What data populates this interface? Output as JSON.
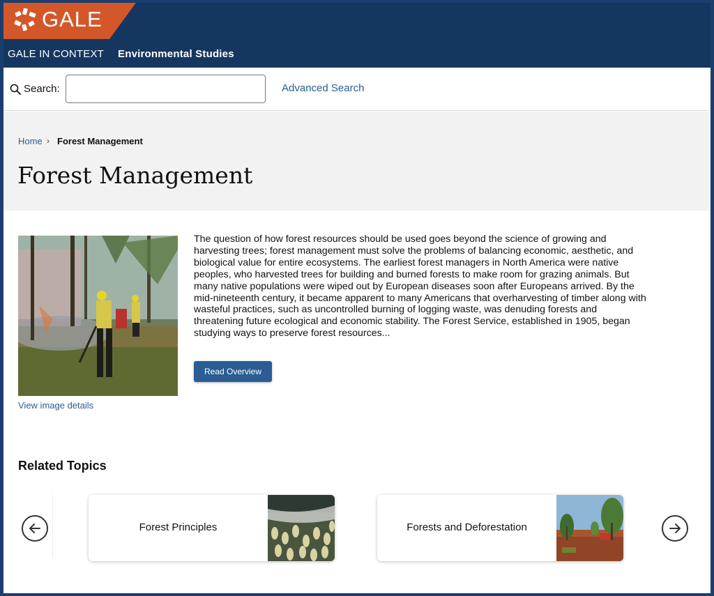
{
  "header": {
    "logo_text": "GALE",
    "product_name": "GALE IN CONTEXT",
    "product_subject": "Environmental Studies"
  },
  "search": {
    "label": "Search:",
    "value": "",
    "placeholder": "",
    "advanced_label": "Advanced Search"
  },
  "breadcrumb": {
    "home": "Home",
    "separator": "›",
    "current": "Forest Management"
  },
  "page": {
    "title": "Forest Management",
    "overview_text": "The question of how forest resources should be used goes beyond the science of growing and harvesting trees; forest management must solve the problems of balancing economic, aesthetic, and biological value for entire ecosystems. The earliest forest managers in North America were native peoples, who harvested trees for building and burned forests to make room for grazing animals. But many native populations were wiped out by European diseases soon after Europeans arrived. By the mid-nineteenth century, it became apparent to many Americans that overharvesting of timber along with wasteful practices, such as uncontrolled burning of logging waste, was denuding forests and threatening future ecological and economic stability. The Forest Service, established in 1905, began studying ways to preserve forest resources...",
    "read_button": "Read Overview",
    "image_details_link": "View image details"
  },
  "related": {
    "heading": "Related Topics",
    "topics": [
      {
        "label": "Forest Principles"
      },
      {
        "label": "Forests and Deforestation"
      }
    ]
  },
  "colors": {
    "header_bg": "#15375f",
    "logo_bg": "#d4572a",
    "link": "#2a5d93",
    "band_bg": "#f2f2f2"
  },
  "icons": {
    "search": "search-icon",
    "prev": "arrow-left-circle-icon",
    "next": "arrow-right-circle-icon"
  }
}
